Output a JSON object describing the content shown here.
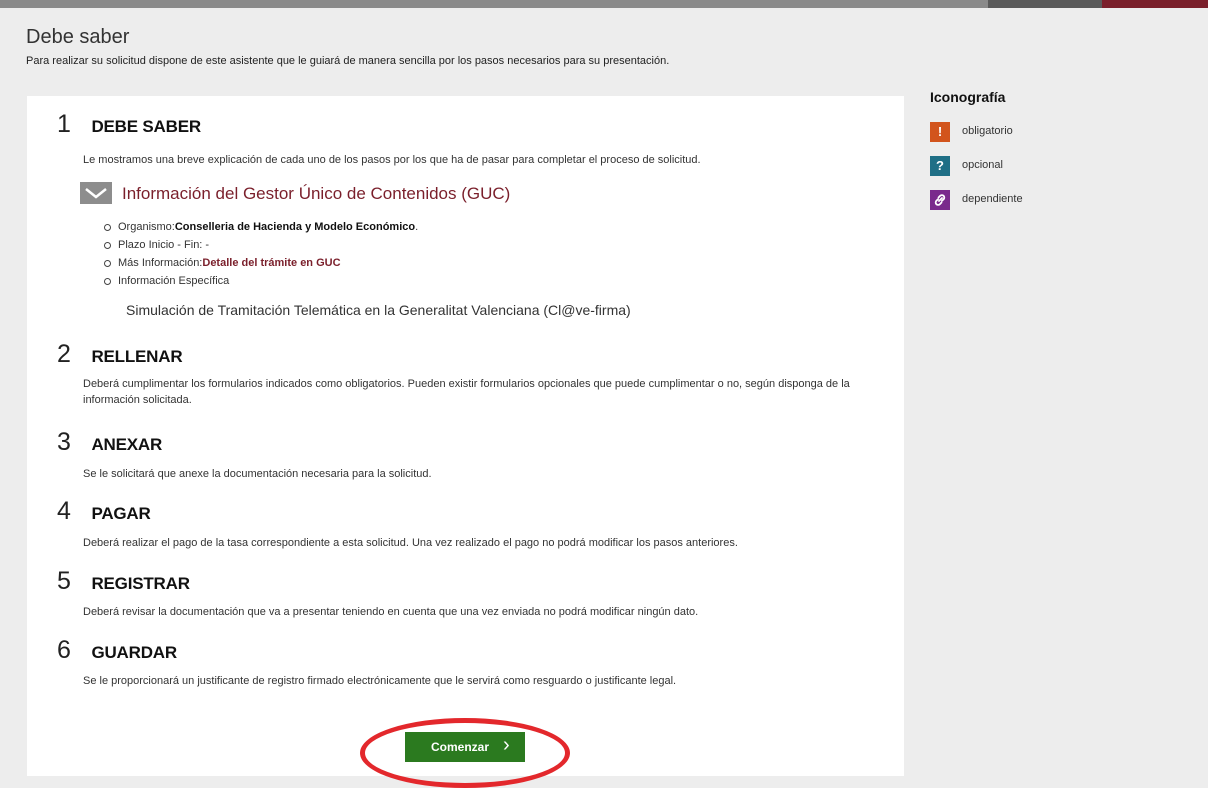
{
  "header": {
    "title": "Debe saber",
    "subtitle": "Para realizar su solicitud dispone de este asistente que le guiará de manera sencilla por los pasos necesarios para su presentación."
  },
  "steps": [
    {
      "number": "1",
      "title": "DEBE SABER",
      "description": "Le mostramos una breve explicación de cada uno de los pasos por los que ha de pasar para completar el proceso de solicitud."
    },
    {
      "number": "2",
      "title": "RELLENAR",
      "description": "Deberá cumplimentar los formularios indicados como obligatorios. Pueden existir formularios opcionales que puede cumplimentar o no, según disponga de la información solicitada."
    },
    {
      "number": "3",
      "title": "ANEXAR",
      "description": "Se le solicitará que anexe la documentación necesaria para la solicitud."
    },
    {
      "number": "4",
      "title": "PAGAR",
      "description": "Deberá realizar el pago de la tasa correspondiente a esta solicitud. Una vez realizado el pago no podrá modificar los pasos anteriores."
    },
    {
      "number": "5",
      "title": "REGISTRAR",
      "description": "Deberá revisar la documentación que va a presentar teniendo en cuenta que una vez enviada no podrá modificar ningún dato."
    },
    {
      "number": "6",
      "title": "GUARDAR",
      "description": "Se le proporcionará un justificante de registro firmado electrónicamente que le servirá como resguardo o justificante legal."
    }
  ],
  "guc": {
    "title": "Información del Gestor Único de Contenidos (GUC)",
    "organismo_label": "Organismo:",
    "organismo_value": "Conselleria de Hacienda y Modelo Económico",
    "organismo_suffix": ".",
    "plazo": "Plazo Inicio - Fin: -",
    "mas_info_label": "Más Información:",
    "mas_info_link": "Detalle del trámite en GUC",
    "especifica_label": "Información Específica",
    "especifica_text": "Simulación de Tramitación Telemática en la Generalitat Valenciana (Cl@ve-firma)"
  },
  "actions": {
    "start_label": "Comenzar"
  },
  "iconography": {
    "title": "Iconografía",
    "items": [
      {
        "icon": "exclamation-icon",
        "glyph": "!",
        "label": "obligatorio",
        "color": "#d2541c"
      },
      {
        "icon": "question-icon",
        "glyph": "?",
        "label": "opcional",
        "color": "#1f6f86"
      },
      {
        "icon": "link-icon",
        "glyph": "",
        "label": "dependiente",
        "color": "#7a2a8c"
      }
    ]
  }
}
